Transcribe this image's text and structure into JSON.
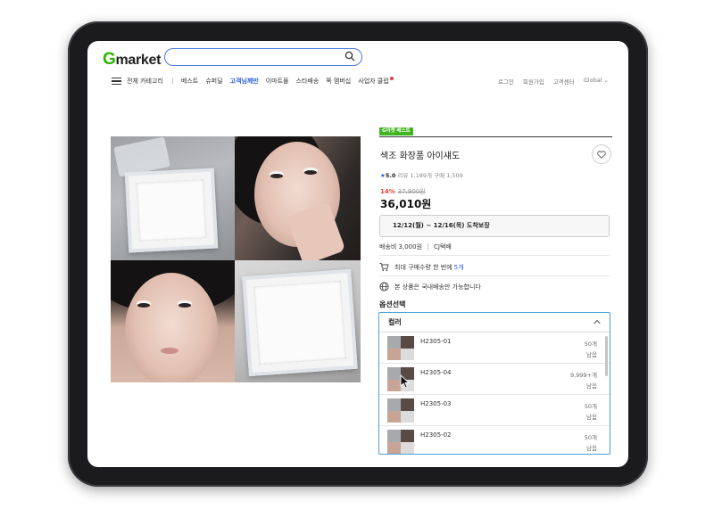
{
  "header": {
    "logo_g": "G",
    "logo_rest": "market",
    "search_placeholder": "",
    "nav": {
      "category_label": "전체 카테고리",
      "items": [
        "베스트",
        "슈퍼딜",
        "고객님께만",
        "이마트몰",
        "스타배송",
        "쪽 멤버십",
        "사업자 클럽"
      ]
    },
    "util": [
      "로그인",
      "회원가입",
      "고객센터",
      "Global ⌄"
    ]
  },
  "product": {
    "badge": "G마켓 베스트",
    "title": "색조 화장품 아이섀도",
    "rating": "5.0",
    "review_label": "리뷰 1,189개",
    "purchase_label": "구매 1,509",
    "discount": "14%",
    "original_price": "37,900원",
    "price": "36,010원",
    "delivery_date": "12/12(월) ~ 12/16(목) 도착보장",
    "shipping_fee": "배송비 3,000원",
    "courier": "CJ택배",
    "max_purchase_text": "최대 구매수량 한 번에",
    "max_purchase_count": "5개",
    "domestic_text": "본 상품은 국내배송만 가능합니다"
  },
  "options": {
    "title": "옵션선택",
    "dropdown_label": "컬러",
    "items": [
      {
        "code": "H2305-01",
        "qty": "50개",
        "status": "남음"
      },
      {
        "code": "H2305-04",
        "qty": "9,999+개",
        "status": "남음"
      },
      {
        "code": "H2305-03",
        "qty": "50개",
        "status": "남음"
      },
      {
        "code": "H2305-02",
        "qty": "50개",
        "status": "남음"
      }
    ]
  },
  "colors": {
    "brand_green": "#2db400",
    "search_blue": "#4a78e6",
    "accent_blue": "#2a5fd8",
    "discount_red": "#e8443c"
  }
}
